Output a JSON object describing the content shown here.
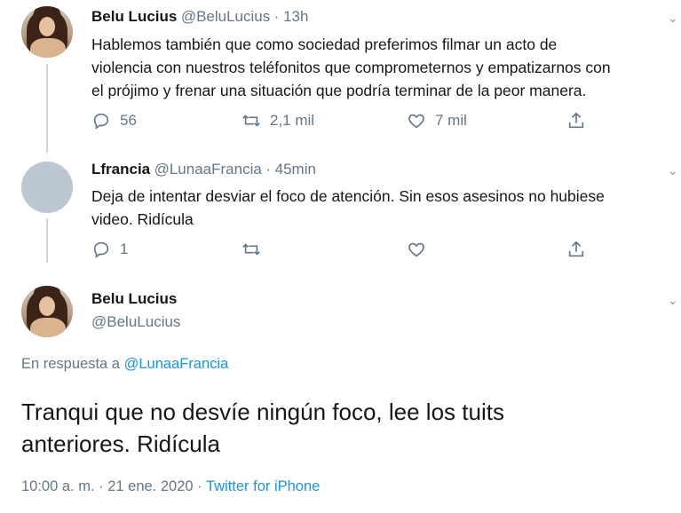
{
  "tweet1": {
    "name": "Belu Lucius",
    "handle": "@BeluLucius",
    "time": "· 13h",
    "text_line1": "Hablemos también que como sociedad preferimos filmar un acto de",
    "text_line2": "violencia con nuestros teléfonitos que comprometernos y empatizarnos con",
    "text_line3": "el prójimo y frenar una situación que podría terminar de la peor manera.",
    "replies": "56",
    "retweets": "2,1 mil",
    "likes": "7 mil"
  },
  "tweet2": {
    "name": "Lfrancia",
    "handle": "@LunaaFrancia",
    "time": "· 45min",
    "text_line1": "Deja de intentar desviar el foco de atención. Sin esos asesinos no hubiese",
    "text_line2": "video. Ridícula",
    "replies": "1"
  },
  "main_tweet": {
    "name": "Belu Lucius",
    "handle": "@BeluLucius",
    "reply_prefix": "En respuesta a",
    "reply_to": "@LunaaFrancia",
    "text_line1": "Tranqui que no desvíe ningún foco, lee los tuits",
    "text_line2": "anteriores. Ridícula",
    "timestamp": "10:00 a. m. · 21 ene. 2020 ·",
    "source": "Twitter for iPhone"
  },
  "colors": {
    "link": "#1b95e0",
    "secondary_text": "#657786",
    "thread_line": "#ccd6dd"
  },
  "icons": [
    "reply-icon",
    "retweet-icon",
    "like-icon",
    "share-icon",
    "chevron-down-icon"
  ]
}
